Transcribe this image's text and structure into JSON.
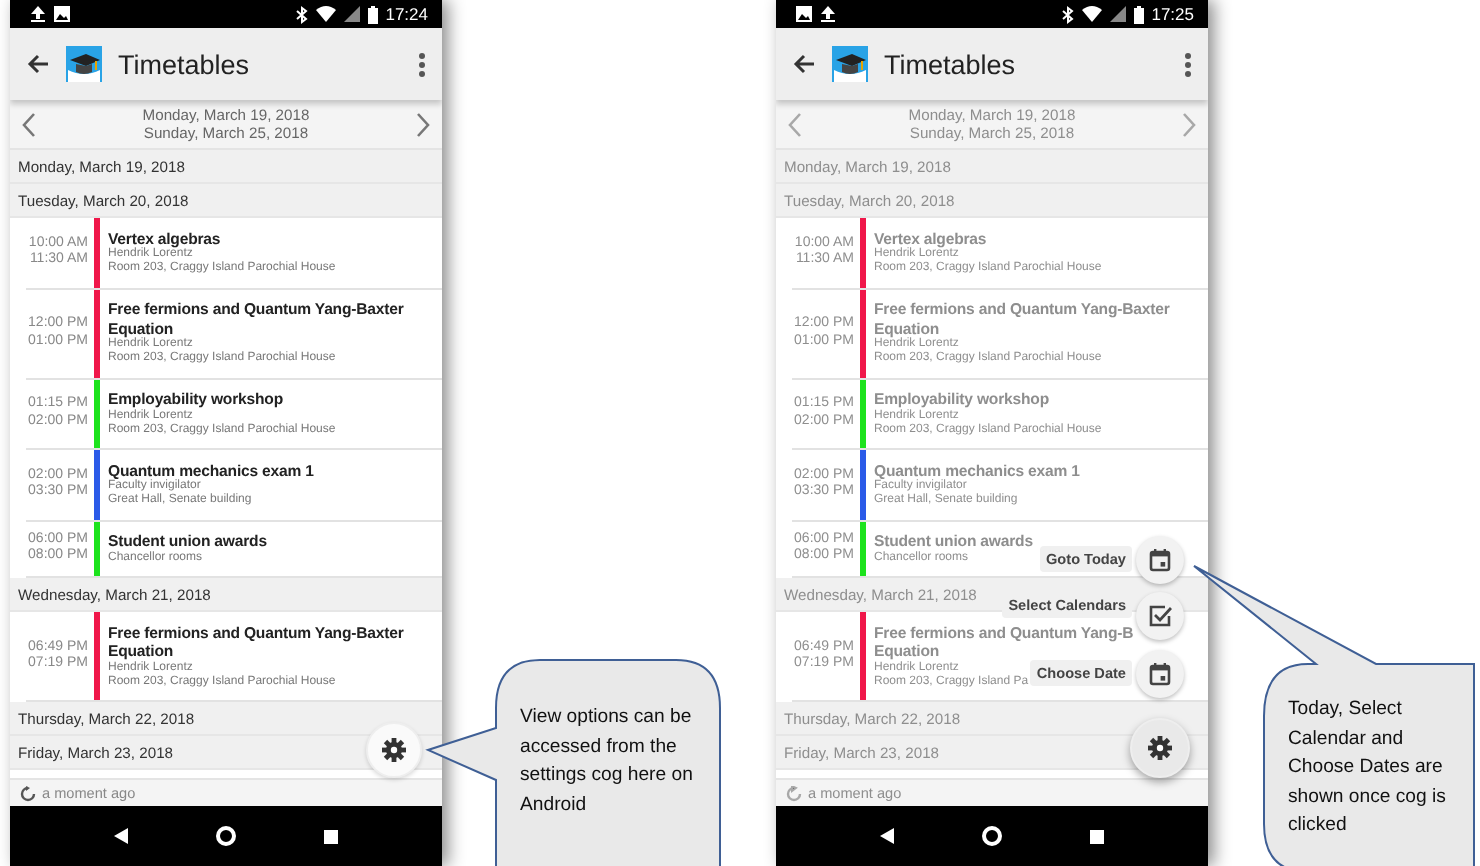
{
  "screens": [
    {
      "notifications": [
        {
          "kind": "upload"
        },
        {
          "kind": "image"
        }
      ],
      "time": "17:24",
      "title": "Timetables",
      "range_start": "Monday, March 19, 2018",
      "range_end": "Sunday, March 25, 2018",
      "menu_open": false,
      "days": [
        {
          "label": "Monday, March 19, 2018"
        },
        {
          "label": "Tuesday, March 20, 2018",
          "events": [
            {
              "start": "10:00 AM",
              "end": "11:30 AM",
              "title": "Vertex algebras",
              "lines": [
                "Hendrik Lorentz",
                "Room 203, Craggy Island Parochial House"
              ],
              "color": "#f0174a"
            },
            {
              "start": "12:00 PM",
              "end": "01:00 PM",
              "title": "Free fermions and Quantum Yang-Baxter Equation",
              "lines": [
                "Hendrik Lorentz",
                "Room 203, Craggy Island Parochial House"
              ],
              "color": "#f0174a"
            },
            {
              "start": "01:15 PM",
              "end": "02:00 PM",
              "title": "Employability workshop",
              "lines": [
                "Hendrik Lorentz",
                "Room 203, Craggy Island Parochial House"
              ],
              "color": "#1de31d"
            },
            {
              "start": "02:00 PM",
              "end": "03:30 PM",
              "title": "Quantum mechanics exam 1",
              "lines": [
                "Faculty invigilator",
                "Great Hall, Senate building"
              ],
              "color": "#2a5ae8"
            },
            {
              "start": "06:00 PM",
              "end": "08:00 PM",
              "title": "Student union awards",
              "lines": [
                "Chancellor rooms"
              ],
              "color": "#1de31d"
            }
          ]
        },
        {
          "label": "Wednesday, March 21, 2018",
          "events": [
            {
              "start": "06:49 PM",
              "end": "07:19 PM",
              "title": "Free fermions and Quantum Yang-Baxter Equation",
              "lines": [
                "Hendrik Lorentz",
                "Room 203, Craggy Island Parochial House"
              ],
              "color": "#f0174a"
            }
          ]
        },
        {
          "label": "Thursday, March 22, 2018"
        },
        {
          "label": "Friday, March 23, 2018"
        }
      ],
      "footer": "a moment ago"
    },
    {
      "notifications": [
        {
          "kind": "image"
        },
        {
          "kind": "upload"
        }
      ],
      "time": "17:25",
      "title": "Timetables",
      "range_start": "Monday, March 19, 2018",
      "range_end": "Sunday, March 25, 2018",
      "menu_open": true,
      "days": [
        {
          "label": "Monday, March 19, 2018"
        },
        {
          "label": "Tuesday, March 20, 2018",
          "events": [
            {
              "start": "10:00 AM",
              "end": "11:30 AM",
              "title": "Vertex algebras",
              "lines": [
                "Hendrik Lorentz",
                "Room 203, Craggy Island Parochial House"
              ],
              "color": "#f0174a"
            },
            {
              "start": "12:00 PM",
              "end": "01:00 PM",
              "title": "Free fermions and Quantum Yang-Baxter Equation",
              "lines": [
                "Hendrik Lorentz",
                "Room 203, Craggy Island Parochial House"
              ],
              "color": "#f0174a"
            },
            {
              "start": "01:15 PM",
              "end": "02:00 PM",
              "title": "Employability workshop",
              "lines": [
                "Hendrik Lorentz",
                "Room 203, Craggy Island Parochial House"
              ],
              "color": "#1de31d"
            },
            {
              "start": "02:00 PM",
              "end": "03:30 PM",
              "title": "Quantum mechanics exam 1",
              "lines": [
                "Faculty invigilator",
                "Great Hall, Senate building"
              ],
              "color": "#2a5ae8"
            },
            {
              "start": "06:00 PM",
              "end": "08:00 PM",
              "title": "Student union awards",
              "lines": [
                "Chancellor rooms"
              ],
              "color": "#1de31d"
            }
          ]
        },
        {
          "label": "Wednesday, March 21, 2018",
          "events": [
            {
              "start": "06:49 PM",
              "end": "07:19 PM",
              "title": "Free fermions and Quantum Yang-B\nEquation",
              "lines": [
                "Hendrik Lorentz",
                "Room 203, Craggy Island Pa"
              ],
              "color": "#f0174a"
            }
          ]
        },
        {
          "label": "Thursday, March 22, 2018"
        },
        {
          "label": "Friday, March 23, 2018"
        }
      ],
      "footer": "a moment ago",
      "menu": [
        {
          "label": "Goto Today",
          "kind": "calendar"
        },
        {
          "label": "Select Calendars",
          "kind": "checkbox"
        },
        {
          "label": "Choose Date",
          "kind": "calendar"
        }
      ]
    }
  ],
  "callouts": [
    {
      "text": "View options can be accessed from the settings cog here on Android"
    },
    {
      "text": "Today, Select Calendar and Choose Dates are shown once cog is clicked"
    }
  ]
}
